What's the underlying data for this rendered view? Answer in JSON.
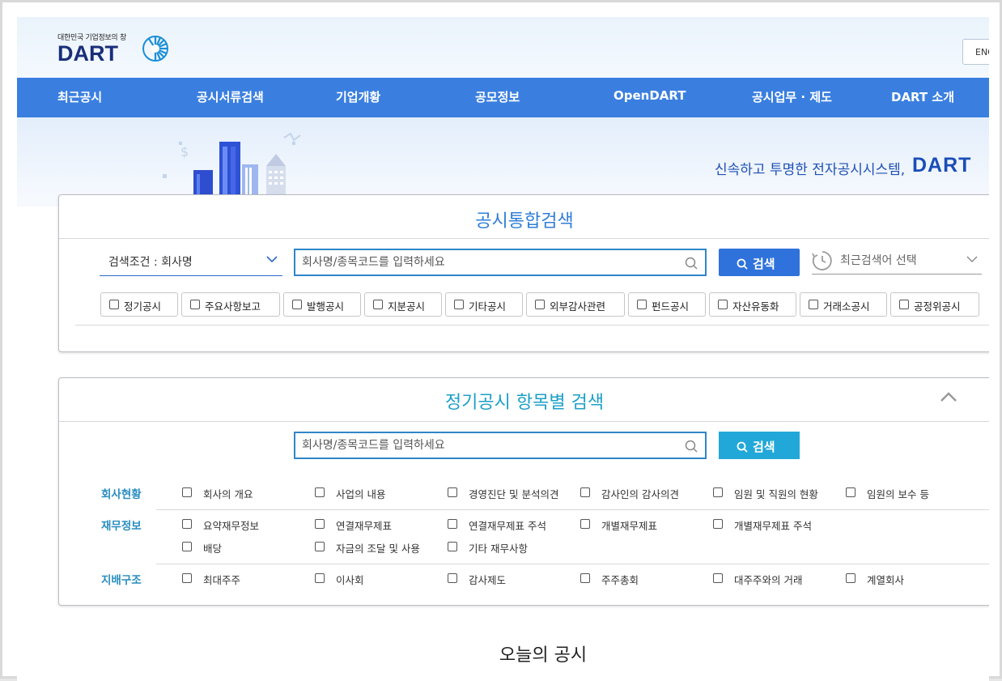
{
  "header": {
    "logo_tagline": "대한민국 기업정보의 창",
    "logo_word": "DART",
    "lang_label": "ENG"
  },
  "nav": {
    "items": [
      "최근공시",
      "공시서류검색",
      "기업개황",
      "공모정보",
      "OpenDART",
      "공시업무 · 제도",
      "DART 소개"
    ]
  },
  "hero": {
    "slogan": "신속하고 투명한 전자공시시스템,",
    "brand": "DART"
  },
  "integrated_search": {
    "title": "공시통합검색",
    "condition_label": "검색조건 : 회사명",
    "input_placeholder": "회사명/종목코드를 입력하세요",
    "search_button": "검색",
    "recent_label": "최근검색어 선택",
    "types": [
      "정기공시",
      "주요사항보고",
      "발행공시",
      "지분공시",
      "기타공시",
      "외부감사관련",
      "펀드공시",
      "자산유동화",
      "거래소공시",
      "공정위공시"
    ]
  },
  "item_search": {
    "title": "정기공시 항목별 검색",
    "input_placeholder": "회사명/종목코드를 입력하세요",
    "search_button": "검색",
    "categories": [
      {
        "label": "회사현황",
        "items": [
          "회사의 개요",
          "사업의 내용",
          "경영진단 및 분석의견",
          "감사인의 감사의견",
          "임원 및 직원의 현황",
          "임원의 보수 등"
        ]
      },
      {
        "label": "재무정보",
        "items": [
          "요약재무정보",
          "연결재무제표",
          "연결재무제표 주석",
          "개별재무제표",
          "개별재무제표 주석",
          "배당",
          "자금의 조달 및 사용",
          "기타 재무사항"
        ]
      },
      {
        "label": "지배구조",
        "items": [
          "최대주주",
          "이사회",
          "감사제도",
          "주주총회",
          "대주주와의 거래",
          "계열회사"
        ]
      }
    ]
  },
  "today": {
    "title": "오늘의 공시"
  },
  "colors": {
    "nav_bg": "#3a7fe0",
    "primary_button": "#2f72db",
    "teal_button": "#22a8d8",
    "title_blue": "#2f7ed8",
    "title_teal": "#1c9fc8",
    "category_label": "#2a8ec0"
  }
}
